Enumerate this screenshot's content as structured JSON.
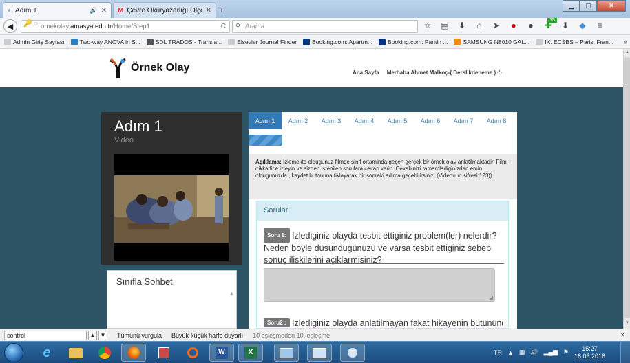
{
  "browser": {
    "tabs": [
      {
        "label": "Adım 1",
        "active": true
      },
      {
        "label": "Çevre Okuryazarlığı Ölçeği ...",
        "active": false
      }
    ],
    "url_prefix": "ornekolay.",
    "url_domain": "amasya.edu.tr",
    "url_path": "/Home/Step1",
    "search_placeholder": "Arama",
    "bookmarks": [
      "Admin Giriş Sayfası",
      "Two-way ANOVA in S...",
      "SDL TRADOS - Transla...",
      "Elsevier Journal Finder",
      "Booking.com: Apartm...",
      "Booking.com: Pantin ...",
      "SAMSUNG N8010 GAL...",
      "IX. ECSBS – Paris, Fran..."
    ],
    "bookmarks_overflow": "»",
    "addon_badge": "15"
  },
  "site": {
    "logo_text": "Örnek Olay",
    "nav_home": "Ana Sayfa",
    "greeting": "Merhaba Ahmet Malkoç-( Derslikdeneme )"
  },
  "lesson": {
    "title": "Adım 1",
    "subtitle": "Video",
    "chat_title": "Sınıfla Sohbet"
  },
  "steps": [
    "Adım 1",
    "Adım 2",
    "Adım 3",
    "Adım 4",
    "Adım 5",
    "Adım 6",
    "Adım 7",
    "Adım 8"
  ],
  "active_step": 0,
  "progress_fraction": 0.125,
  "description": {
    "label": "Açıklama:",
    "text": " İzlemekte oldugunuz filmde sinif ortaminda geçen gerçek bir örnek olay anlatilmaktadir. Filmi dikkatlice izleyin ve sizden istenilen sorulara cevap verin. Cevabinizi tamamladiginizdan emin oldugunuzda , kaydet butonuna tiklayarak bir sonraki adima geçebilirsiniz. (Videonun sifresi:123))"
  },
  "questions": {
    "heading": "Sorular",
    "items": [
      {
        "badge": "Soru 1:",
        "text": "Izlediginiz olayda tesbit ettiginiz problem(ler) nelerdir? Neden böyle düsündügünüzü ve varsa tesbit ettiginiz sebep sonuç iliskilerini açiklarmisiniz?"
      },
      {
        "badge": "Soru2 :",
        "text": "Izlediginiz olayda anlatilmayan fakat hikayenin bütününde"
      }
    ]
  },
  "findbar": {
    "query": "control",
    "highlight_all": "Tümünü vurgula",
    "match_case": "Büyük-küçük harfe duyarlı",
    "status": "10 eşleşmeden 10. eşleşme"
  },
  "taskbar": {
    "language": "TR",
    "time": "15:27",
    "date": "18.03.2016",
    "apps": [
      "ie-icon",
      "explorer-icon",
      "chrome-icon",
      "firefox-icon",
      "paint-icon",
      "origin-icon",
      "word-icon",
      "excel-icon",
      "screen-icon",
      "tablet-icon",
      "pidgin-icon"
    ]
  },
  "colors": {
    "accent_blue": "#337ab7",
    "page_background": "#2e5566",
    "panel_dark": "#2f2f2f"
  }
}
